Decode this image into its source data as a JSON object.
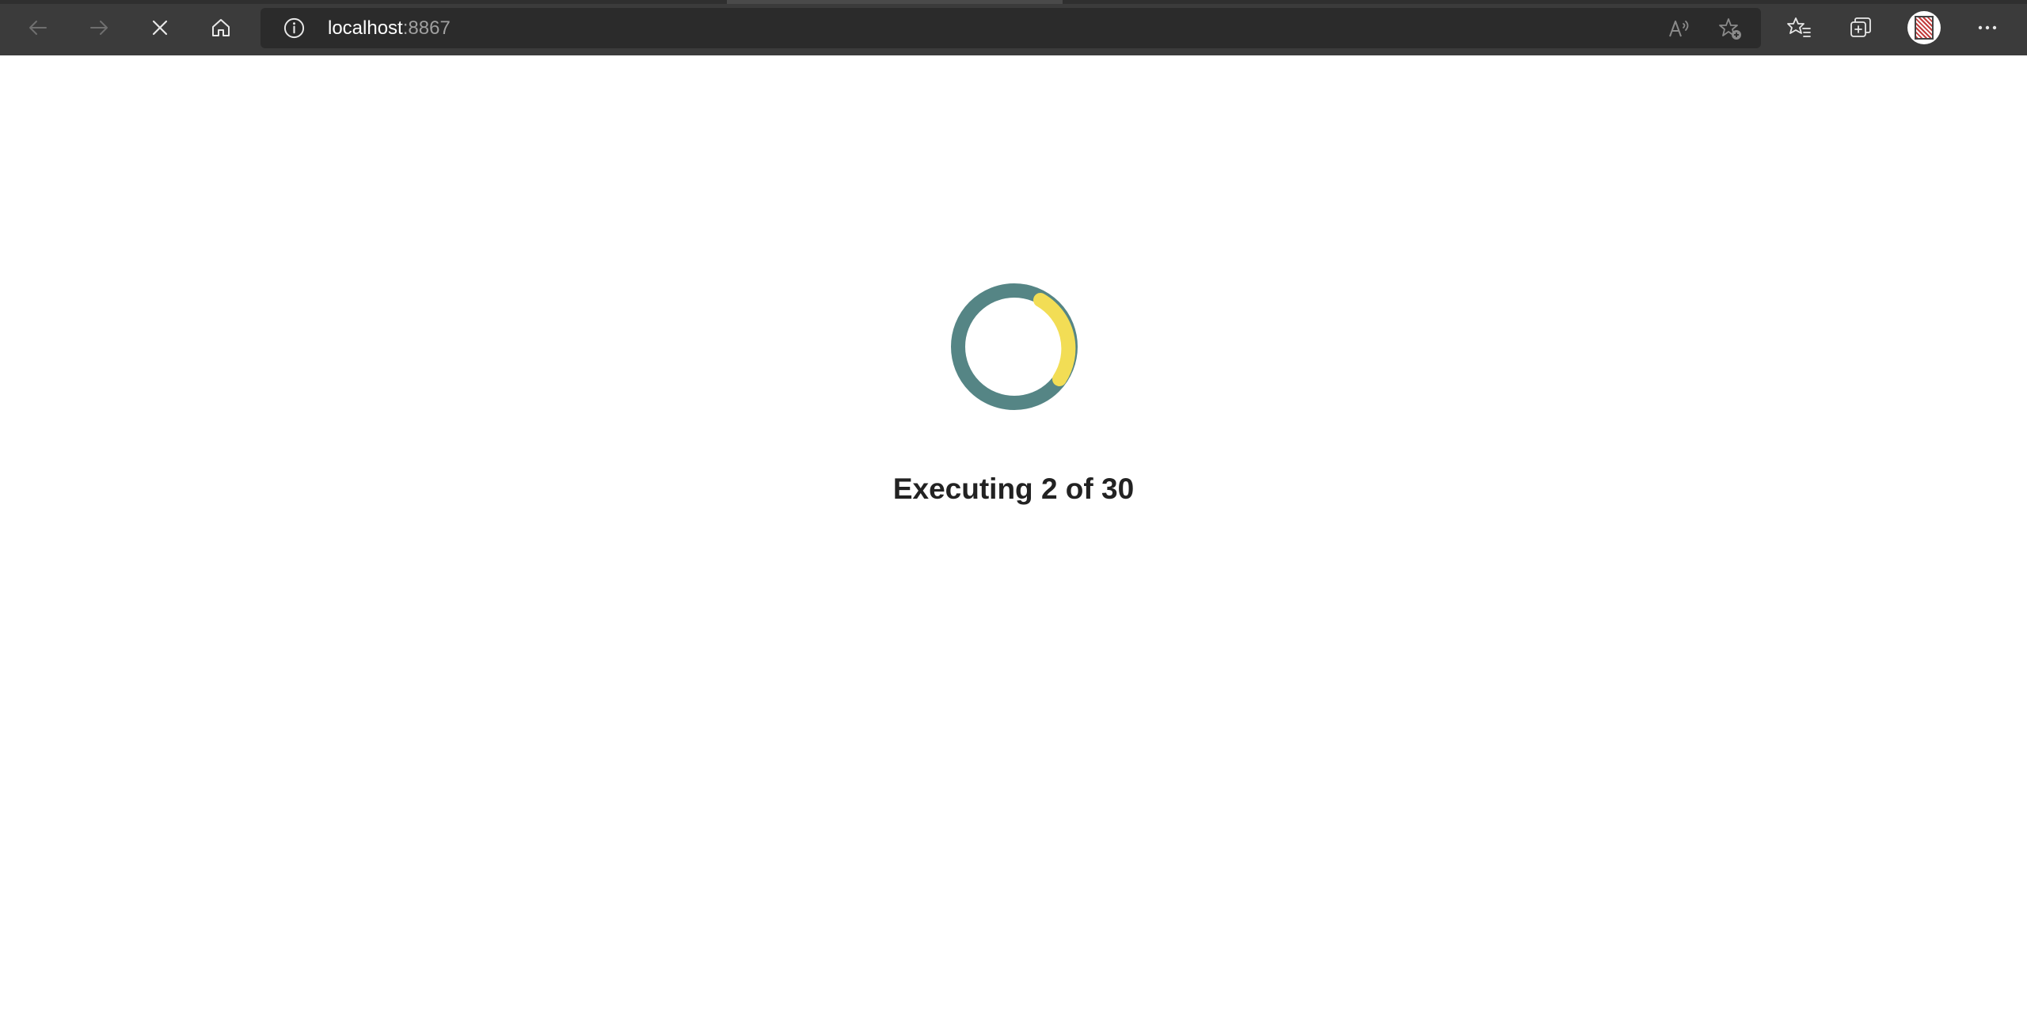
{
  "browser": {
    "url_host": "localhost",
    "url_port": ":8867",
    "icons": {
      "back": "back-arrow-icon",
      "forward": "forward-arrow-icon",
      "stop": "close-icon",
      "home": "home-icon",
      "info": "info-icon",
      "read_aloud": "read-aloud-icon",
      "add_favorite": "add-favorite-icon",
      "favorites": "favorites-icon",
      "collections": "collections-icon",
      "profile": "avatar",
      "menu": "more-icon"
    },
    "colors": {
      "toolbar": "#3b3b3b",
      "address_bar": "#2b2b2b"
    }
  },
  "main": {
    "status_text": "Executing 2 of 30",
    "progress": {
      "current": 2,
      "total": 30
    },
    "spinner_colors": {
      "track": "#558585",
      "arc": "#f2dd55"
    }
  }
}
